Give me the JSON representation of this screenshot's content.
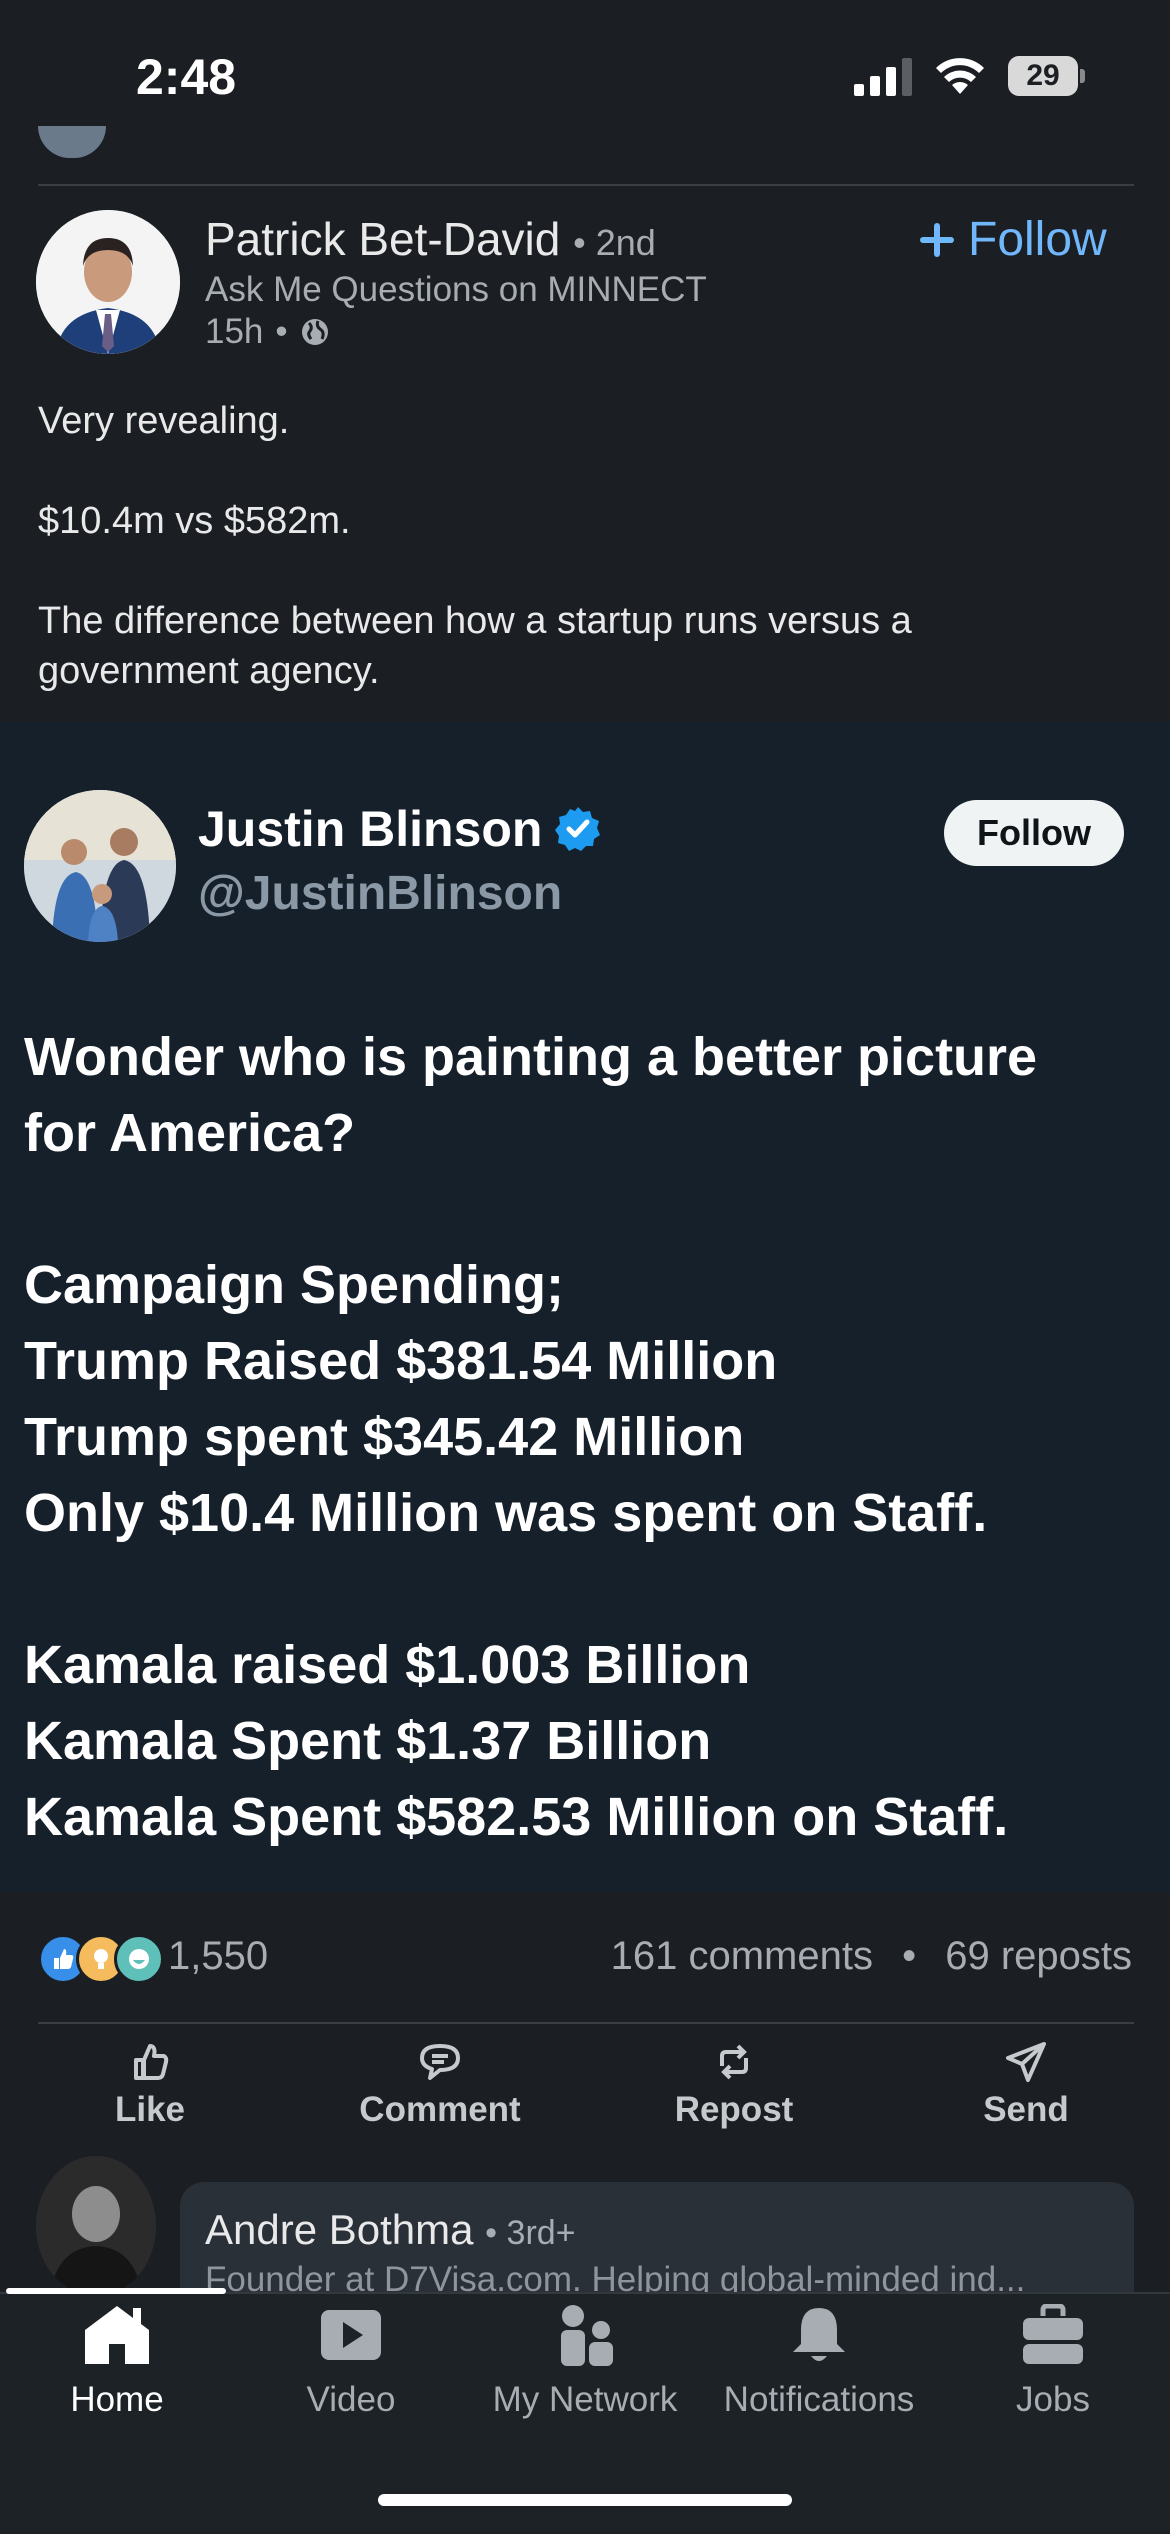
{
  "status_bar": {
    "time": "2:48",
    "battery": "29"
  },
  "post": {
    "author": {
      "name": "Patrick Bet-David",
      "degree": "2nd",
      "headline": "Ask Me Questions on MINNECT",
      "time": "15h"
    },
    "follow_label": "Follow",
    "text": [
      "Very revealing.",
      "$10.4m vs $582m.",
      "The difference between how a startup runs versus a",
      "government agency."
    ],
    "tweet": {
      "name": "Justin Blinson",
      "handle": "@JustinBlinson",
      "follow_label": "Follow",
      "lines": [
        "Wonder who is painting a better picture",
        "for America?",
        "Campaign Spending;",
        "Trump Raised $381.54 Million",
        "Trump spent $345.42 Million",
        "Only $10.4 Million was spent on Staff.",
        "Kamala raised $1.003 Billion",
        "Kamala Spent $1.37 Billion",
        "Kamala Spent $582.53 Million on Staff."
      ]
    },
    "reaction_count": "1,550",
    "comments": "161 comments",
    "separator": "•",
    "reposts": "69 reposts",
    "actions": {
      "like": "Like",
      "comment": "Comment",
      "repost": "Repost",
      "send": "Send"
    }
  },
  "next_post": {
    "name": "Andre Bothma",
    "degree": "3rd+",
    "headline": "Founder at D7Visa.com. Helping global-minded ind..."
  },
  "bottom_nav": {
    "home": "Home",
    "video": "Video",
    "network": "My Network",
    "notifications": "Notifications",
    "jobs": "Jobs"
  },
  "colors": {
    "background": "#1b1f23",
    "accent": "#71b7fb",
    "tweet_bg": "#15202b",
    "verified": "#1d9bf0"
  }
}
